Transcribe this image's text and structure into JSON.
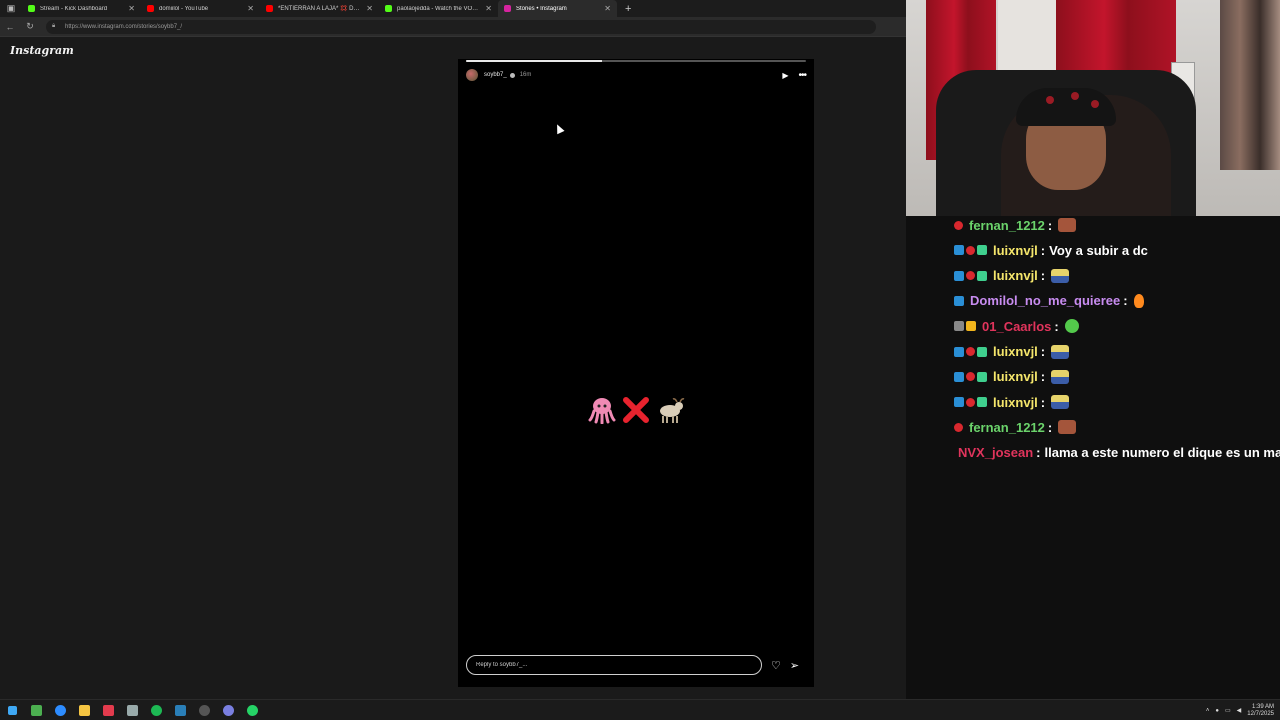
{
  "browser": {
    "tabs": [
      {
        "title": "Stream - Kick Dashboard",
        "color": "#53fc18",
        "active": false
      },
      {
        "title": "domiilol - YouTube",
        "color": "#ff0000",
        "active": false
      },
      {
        "title": "*ENTIERRAN A LAJA* 💢 DOMIIL...",
        "color": "#ff0000",
        "active": false
      },
      {
        "title": "paolaojedda - Watch the VOD on...",
        "color": "#53fc18",
        "active": false
      },
      {
        "title": "Stories • Instagram",
        "color": "#d6249f",
        "active": true
      }
    ],
    "new_tab": "+",
    "url": "https://www.instagram.com/stories/soybb7_/"
  },
  "instagram": {
    "logo": "Instagram",
    "story": {
      "username": "soybb7_",
      "time_ago": "16m",
      "progress": 0.4,
      "emojis": [
        "🐙",
        "❌",
        "🐐"
      ],
      "reply_placeholder": "Reply to soybb7_..."
    }
  },
  "chat": {
    "messages": [
      {
        "user": "fernan_1212",
        "color": "#6bd36b",
        "badges": [
          "red"
        ],
        "text": "",
        "emote": "face"
      },
      {
        "user": "luixnvjl",
        "color": "#f5e66b",
        "badges": [
          "blue",
          "red",
          "teal"
        ],
        "text": "Voy a subir a dc",
        "emote": ""
      },
      {
        "user": "luixnvjl",
        "color": "#f5e66b",
        "badges": [
          "blue",
          "red",
          "teal"
        ],
        "text": "",
        "emote": "car"
      },
      {
        "user": "Domilol_no_me_quieree",
        "color": "#c88cf0",
        "badges": [
          "blue"
        ],
        "text": "",
        "emote": "fire"
      },
      {
        "user": "01_Caarlos",
        "color": "#e0345c",
        "badges": [
          "gray",
          "gold"
        ],
        "text": "",
        "emote": "green"
      },
      {
        "user": "luixnvjl",
        "color": "#f5e66b",
        "badges": [
          "blue",
          "red",
          "teal"
        ],
        "text": "",
        "emote": "car"
      },
      {
        "user": "luixnvjl",
        "color": "#f5e66b",
        "badges": [
          "blue",
          "red",
          "teal"
        ],
        "text": "",
        "emote": "car"
      },
      {
        "user": "luixnvjl",
        "color": "#f5e66b",
        "badges": [
          "blue",
          "red",
          "teal"
        ],
        "text": "",
        "emote": "car"
      },
      {
        "user": "fernan_1212",
        "color": "#6bd36b",
        "badges": [
          "red"
        ],
        "text": "",
        "emote": "face"
      },
      {
        "user": "NVX_josean",
        "color": "#e0345c",
        "badges": [],
        "text": "llama a este numero el dique es un mal",
        "emote": ""
      }
    ]
  },
  "taskbar": {
    "time": "1:39 AM",
    "date": "12/7/2025"
  }
}
